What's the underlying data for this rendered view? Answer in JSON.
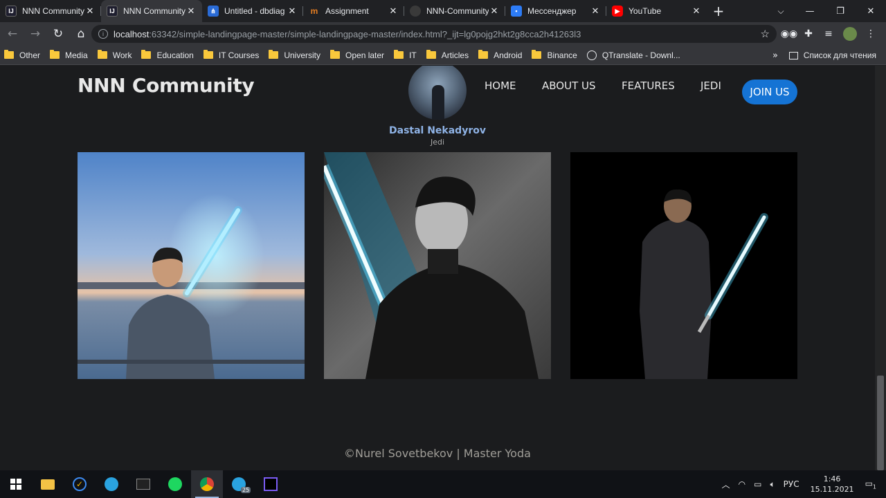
{
  "browser": {
    "tabs": [
      {
        "title": "NNN Community",
        "favicon": "intellij-icon",
        "color": "#1e1e2e",
        "active": false
      },
      {
        "title": "NNN Community",
        "favicon": "intellij-icon",
        "color": "#1e1e2e",
        "active": true
      },
      {
        "title": "Untitled - dbdiag",
        "favicon": "share-icon",
        "color": "#2a6bd6",
        "active": false
      },
      {
        "title": "Assignment",
        "favicon": "moodle-icon",
        "color": "#e67e22",
        "active": false
      },
      {
        "title": "NNN-Community",
        "favicon": "github-icon",
        "color": "#3a3a3a",
        "active": false
      },
      {
        "title": "Мессенджер",
        "favicon": "messenger-icon",
        "color": "#2d7cf6",
        "active": false
      },
      {
        "title": "YouTube",
        "favicon": "youtube-icon",
        "color": "#ff0000",
        "active": false
      }
    ],
    "address": {
      "host": "localhost",
      "path": ":63342/simple-landingpage-master/simple-landingpage-master/index.html?_ijt=lg0pojg2hkt2g8cca2h41263l3"
    },
    "bookmarks": [
      "Other",
      "Media",
      "Work",
      "Education",
      "IT Courses",
      "University",
      "Open later",
      "IT",
      "Articles",
      "Android",
      "Binance"
    ],
    "bookmark_link": "QTranslate - Downl...",
    "more": "»",
    "reading_list": "Список для чтения"
  },
  "site": {
    "brand": "NNN Community",
    "nav": {
      "home": "HOME",
      "about": "ABOUT US",
      "features": "FEATURES",
      "jedi": "JEDI",
      "join": "JOIN US"
    },
    "member": {
      "name": "Dastal Nekadyrov",
      "role": "Jedi"
    },
    "footer": "©Nurel Sovetbekov | Master Yoda"
  },
  "taskbar": {
    "lang": "РУС",
    "time": "1:46",
    "date": "15.11.2021",
    "notification_count": "1",
    "telegram_badge": "25"
  },
  "colors": {
    "accent": "#1573d4",
    "lightsaber": "#00c8ff"
  }
}
